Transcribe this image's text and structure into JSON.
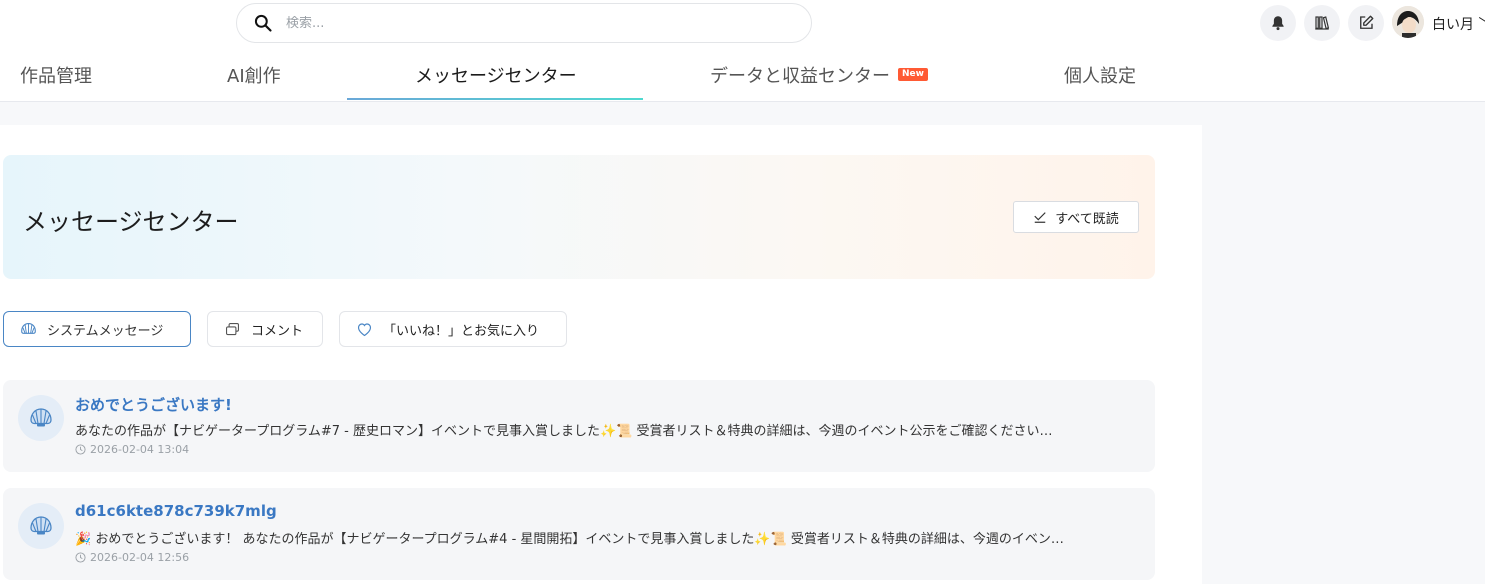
{
  "search": {
    "placeholder": "検索..."
  },
  "user": {
    "name": "白い月 ﹀"
  },
  "tabs": [
    {
      "label": "作品管理"
    },
    {
      "label": "AI創作"
    },
    {
      "label": "メッセージセンター",
      "active": true
    },
    {
      "label": "データと収益センター",
      "badge": "New"
    },
    {
      "label": "個人設定"
    }
  ],
  "hero": {
    "title": "メッセージセンター",
    "mark_all_label": "すべて既読"
  },
  "filters": [
    {
      "label": "システムメッセージ",
      "icon": "shell-icon",
      "active": true
    },
    {
      "label": "コメント",
      "icon": "comment-icon"
    },
    {
      "label": "「いいね！」とお気に入り",
      "icon": "heart-icon"
    }
  ],
  "messages": [
    {
      "title": "おめでとうございます!",
      "body": "あなたの作品が【ナビゲータープログラム#7 - 歴史ロマン】イベントで見事入賞しました✨📜 受賞者リスト＆特典の詳細は、今週のイベント公示をご確認ください…",
      "time": "2026-02-04 13:04"
    },
    {
      "title": "d61c6kte878c739k7mlg",
      "body": "🎉 おめでとうございます！ あなたの作品が【ナビゲータープログラム#4 - 星間開拓】イベントで見事入賞しました✨📜 受賞者リスト＆特典の詳細は、今週のイベン…",
      "time": "2026-02-04 12:56"
    }
  ],
  "colors": {
    "accent_blue": "#3a78c3",
    "badge_red": "#ff5a34",
    "underline_teal": "#4fd9d0"
  }
}
